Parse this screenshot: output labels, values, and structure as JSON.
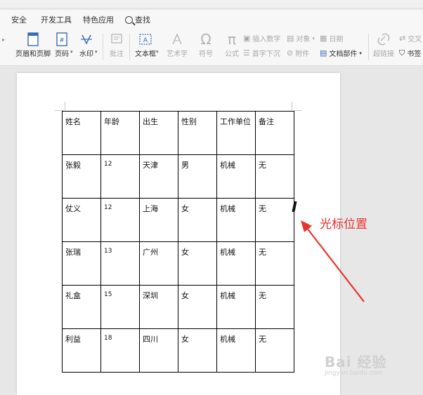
{
  "menu": {
    "tabs": [
      "安全",
      "开发工具",
      "特色应用"
    ],
    "search_label": "查找"
  },
  "ribbon": {
    "header_footer": "页眉和页脚",
    "page_number": "页码",
    "watermark": "水印",
    "annotate": "批注",
    "text_box": "文本框",
    "word_art": "艺术字",
    "symbol": "符号",
    "formula": "公式",
    "insert_number": "插入数字",
    "object": "对象",
    "date": "日期",
    "drop_cap": "首字下沉",
    "attachment": "附件",
    "doc_parts": "文档部件",
    "hyperlink": "超链接",
    "cross_ref": "交叉",
    "bookmark": "书签"
  },
  "table": {
    "headers": [
      "姓名",
      "年龄",
      "出生",
      "性别",
      "工作单位",
      "备注"
    ],
    "rows": [
      [
        "张毅",
        "12",
        "天津",
        "男",
        "机械",
        "无"
      ],
      [
        "仗义",
        "12",
        "上海",
        "女",
        "机械",
        "无"
      ],
      [
        "张瑞",
        "13",
        "广州",
        "女",
        "机械",
        "无"
      ],
      [
        "礼盒",
        "15",
        "深圳",
        "女",
        "机械",
        "无"
      ],
      [
        "利益",
        "18",
        "四川",
        "女",
        "机械",
        "无"
      ]
    ]
  },
  "annotation": {
    "text": "光标位置",
    "color": "#e8322e"
  },
  "watermark": {
    "main": "Bai 经验",
    "sub": "jingyan.baidu.com"
  }
}
